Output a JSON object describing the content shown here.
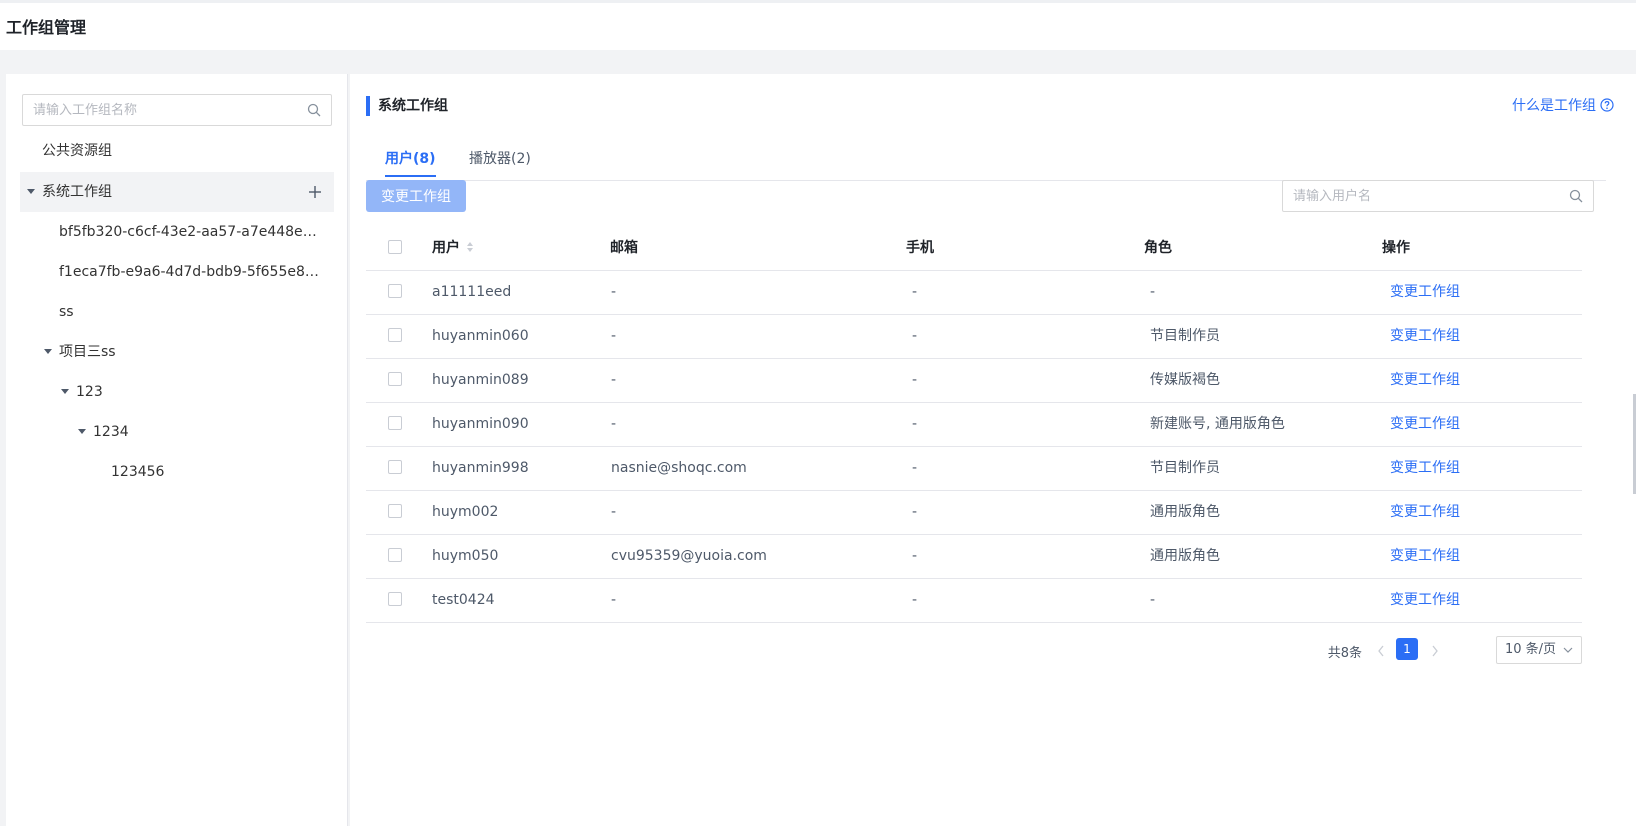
{
  "page": {
    "title": "工作组管理"
  },
  "tree": {
    "search_placeholder": "请输入工作组名称",
    "nodes": [
      {
        "label": "公共资源组"
      },
      {
        "label": "系统工作组"
      },
      {
        "label": "bf5fb320-c6cf-43e2-aa57-a7e448e45..."
      },
      {
        "label": "f1eca7fb-e9a6-4d7d-bdb9-5f655e8eb..."
      },
      {
        "label": "ss"
      },
      {
        "label": "项目三ss"
      },
      {
        "label": "123"
      },
      {
        "label": "1234"
      },
      {
        "label": "123456"
      }
    ]
  },
  "main": {
    "section_title": "系统工作组",
    "help_link": "什么是工作组",
    "tabs": [
      {
        "label": "用户(8)"
      },
      {
        "label": "播放器(2)"
      }
    ],
    "change_button": "变更工作组",
    "user_search_placeholder": "请输入用户名",
    "columns": [
      "用户",
      "邮箱",
      "手机",
      "角色",
      "操作"
    ],
    "rows": [
      {
        "user": "a11111eed",
        "email": "-",
        "phone": "-",
        "role": "-",
        "action": "变更工作组"
      },
      {
        "user": "huyanmin060",
        "email": "-",
        "phone": "-",
        "role": "节目制作员",
        "action": "变更工作组"
      },
      {
        "user": "huyanmin089",
        "email": "-",
        "phone": "-",
        "role": "传媒版褐色",
        "action": "变更工作组"
      },
      {
        "user": "huyanmin090",
        "email": "-",
        "phone": "-",
        "role": "新建账号, 通用版角色",
        "action": "变更工作组"
      },
      {
        "user": "huyanmin998",
        "email": "nasnie@shoqc.com",
        "phone": "-",
        "role": "节目制作员",
        "action": "变更工作组"
      },
      {
        "user": "huym002",
        "email": "-",
        "phone": "-",
        "role": "通用版角色",
        "action": "变更工作组"
      },
      {
        "user": "huym050",
        "email": "cvu95359@yuoia.com",
        "phone": "-",
        "role": "通用版角色",
        "action": "变更工作组"
      },
      {
        "user": "test0424",
        "email": "-",
        "phone": "-",
        "role": "-",
        "action": "变更工作组"
      }
    ],
    "pagination": {
      "total": "共8条",
      "current": "1",
      "page_size": "10 条/页"
    }
  },
  "colors": {
    "primary": "#2b6ef5",
    "button_disabled": "#93b6f8",
    "selected_bg": "#f2f3f5"
  }
}
